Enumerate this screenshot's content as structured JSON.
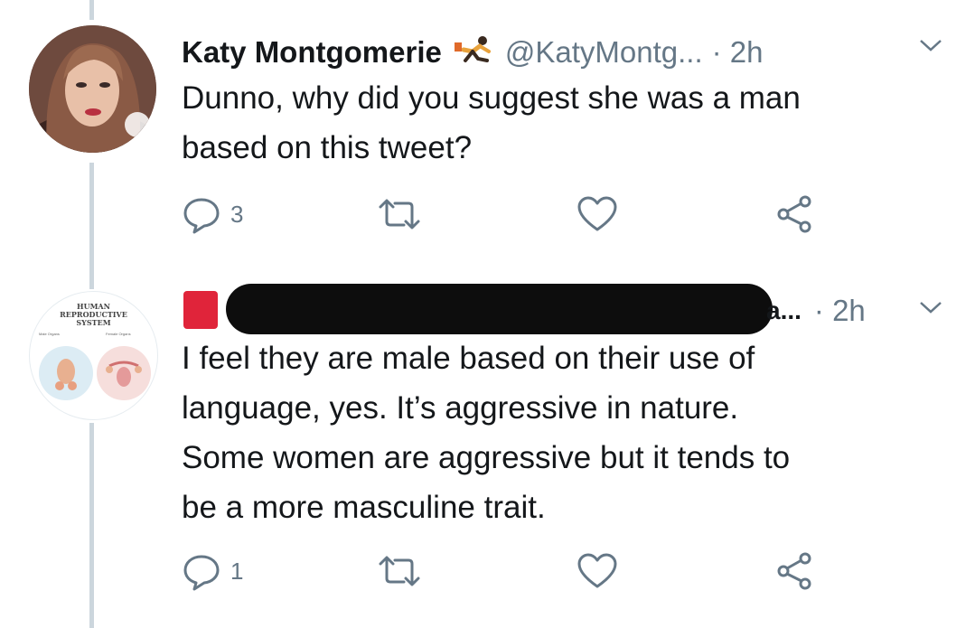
{
  "tweets": [
    {
      "display_name": "Katy Montgomerie",
      "emoji_icon": "running-figure-emoji",
      "handle": "@KatyMontg...",
      "time": "· 2h",
      "text_lines": [
        "Dunno, why did you suggest she was a man",
        "based on this tweet?"
      ],
      "reply_count": "3"
    },
    {
      "display_name_redacted": true,
      "handle_tail": "a...",
      "time": "· 2h",
      "avatar_text": [
        "HUMAN",
        "REPRODUCTIVE",
        "SYSTEM"
      ],
      "avatar_sub": [
        "Male Organs",
        "Female Organs"
      ],
      "text_lines": [
        "I feel they are male based on their use of",
        "language, yes. It’s aggressive in nature.",
        "Some women are aggressive but it tends to",
        "be a more masculine trait."
      ],
      "reply_count": "1"
    }
  ],
  "colors": {
    "text": "#14171a",
    "muted": "#657786",
    "thread_line": "#ccd6dd",
    "redaction_red": "#e0243a"
  }
}
